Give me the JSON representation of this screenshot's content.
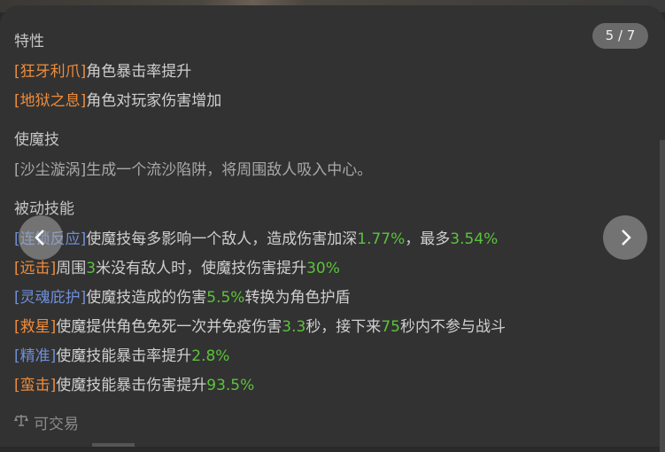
{
  "background": {
    "peek_text": ""
  },
  "counter": {
    "text": "5 / 7"
  },
  "traits": {
    "title": "特性",
    "items": [
      {
        "tag": "[狂牙利爪]",
        "text": "角色暴击率提升"
      },
      {
        "tag": "[地狱之息]",
        "text": "角色对玩家伤害增加"
      }
    ]
  },
  "active_skill": {
    "title": "使魔技",
    "text": "[沙尘漩涡]生成一个流沙陷阱，将周围敌人吸入中心。"
  },
  "passive": {
    "title": "被动技能",
    "items": [
      {
        "tag": "[连锁反应]",
        "tag_color": "blue",
        "parts": [
          "使魔技每多影响一个敌人，造成伤害加深",
          "1.77%",
          "，最多",
          "3.54%"
        ]
      },
      {
        "tag": "[远击]",
        "tag_color": "orange",
        "parts": [
          "周围",
          "3",
          "米没有敌人时，使魔技伤害提升",
          "30%"
        ]
      },
      {
        "tag": "[灵魂庇护]",
        "tag_color": "blue",
        "parts": [
          "使魔技造成的伤害",
          "5.5%",
          "转换为角色护盾"
        ]
      },
      {
        "tag": "[救星]",
        "tag_color": "orange",
        "parts": [
          "使魔提供角色免死一次并免疫伤害",
          "3.3",
          "秒，接下来",
          "75",
          "秒内不参与战斗"
        ]
      },
      {
        "tag": "[精准]",
        "tag_color": "blue",
        "parts": [
          "使魔技能暴击率提升",
          "2.8%"
        ]
      },
      {
        "tag": "[蛮击]",
        "tag_color": "orange",
        "parts": [
          "使魔技能暴击伤害提升",
          "93.5%"
        ]
      }
    ]
  },
  "trade": {
    "label": "可交易",
    "icon": "balance-scale-icon"
  },
  "colors": {
    "orange": "#ef8c3c",
    "blue": "#6f8fd8",
    "green": "#5ac43a"
  }
}
